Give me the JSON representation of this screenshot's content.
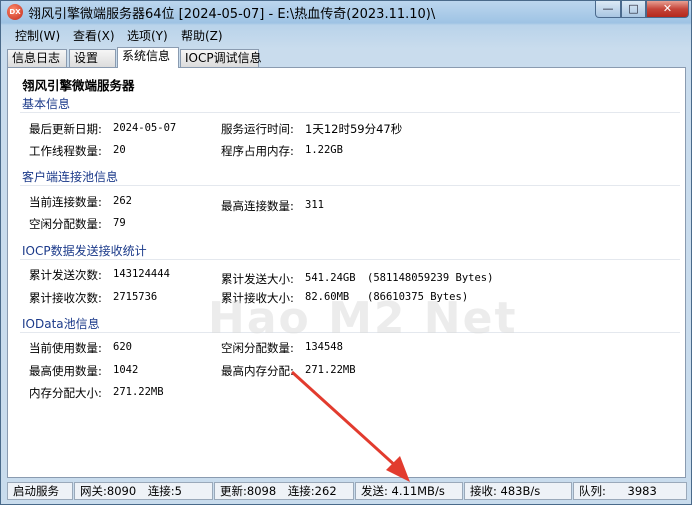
{
  "window": {
    "title": "翎风引擎微端服务器64位 [2024-05-07] - E:\\热血传奇(2023.11.10)\\",
    "icon_label": "DX",
    "minimize_glyph": "—",
    "maximize_glyph": "□",
    "close_glyph": "✕"
  },
  "menu": [
    "控制(W)",
    "查看(X)",
    "选项(Y)",
    "帮助(Z)"
  ],
  "tabs": [
    {
      "label": "信息日志",
      "active": false
    },
    {
      "label": "设置",
      "active": false
    },
    {
      "label": "系统信息",
      "active": true
    },
    {
      "label": "IOCP调试信息",
      "active": false
    }
  ],
  "panel": {
    "app_name": "翎风引擎微端服务器",
    "basic": {
      "title": "基本信息",
      "last_update_label": "最后更新日期:",
      "last_update_value": "2024-05-07",
      "uptime_label": "服务运行时间:",
      "uptime_value": "1天12时59分47秒",
      "threads_label": "工作线程数量:",
      "threads_value": "20",
      "memory_label": "程序占用内存:",
      "memory_value": "1.22GB"
    },
    "pool": {
      "title": "客户端连接池信息",
      "current_label": "当前连接数量:",
      "current_value": "262",
      "max_label": "最高连接数量:",
      "max_value": "311",
      "idle_label": "空闲分配数量:",
      "idle_value": "79"
    },
    "iocp": {
      "title": "IOCP数据发送接收统计",
      "send_count_label": "累计发送次数:",
      "send_count_value": "143124444",
      "send_size_label": "累计发送大小:",
      "send_size_value": "541.24GB",
      "send_bytes_value": "(581148059239 Bytes)",
      "recv_count_label": "累计接收次数:",
      "recv_count_value": "2715736",
      "recv_size_label": "累计接收大小:",
      "recv_size_value": "82.60MB",
      "recv_bytes_value": "(86610375 Bytes)"
    },
    "iodata": {
      "title": "IOData池信息",
      "in_use_label": "当前使用数量:",
      "in_use_value": "620",
      "idle_label": "空闲分配数量:",
      "idle_value": "134548",
      "max_used_label": "最高使用数量:",
      "max_used_value": "1042",
      "max_mem_label": "最高内存分配:",
      "max_mem_value": "271.22MB",
      "mem_alloc_label": "内存分配大小:",
      "mem_alloc_value": "271.22MB"
    }
  },
  "watermark": "Hao M2 Net",
  "status": {
    "start_service": "启动服务",
    "gateway": "网关:8090",
    "gateway_conn": "连接:5",
    "update": "更新:8098",
    "update_conn": "连接:262",
    "send": "发送: 4.11MB/s",
    "recv": "接收: 483B/s",
    "queue_label": "队列:",
    "queue_value": "3983"
  },
  "colors": {
    "section_title": "#1b3a8a",
    "arrow": "#e23b2e",
    "close_button": "#c5453a"
  }
}
